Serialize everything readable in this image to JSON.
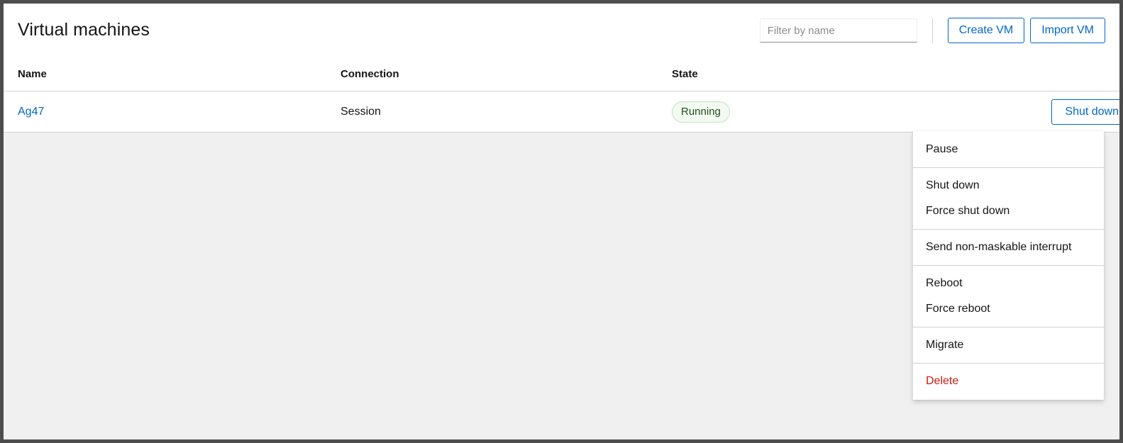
{
  "header": {
    "title": "Virtual machines"
  },
  "toolbar": {
    "filter_placeholder": "Filter by name",
    "filter_value": "",
    "create_vm_label": "Create VM",
    "import_vm_label": "Import VM"
  },
  "table": {
    "columns": [
      "Name",
      "Connection",
      "State",
      ""
    ],
    "rows": [
      {
        "name": "Ag47",
        "connection": "Session",
        "state": "Running",
        "primary_action": "Shut down",
        "kebab_icon": "kebab-vertical-icon"
      }
    ]
  },
  "dropdown": {
    "open": true,
    "groups": [
      {
        "items": [
          {
            "label": "Pause",
            "danger": false
          }
        ]
      },
      {
        "items": [
          {
            "label": "Shut down",
            "danger": false
          },
          {
            "label": "Force shut down",
            "danger": false
          }
        ]
      },
      {
        "items": [
          {
            "label": "Send non-maskable interrupt",
            "danger": false
          }
        ]
      },
      {
        "items": [
          {
            "label": "Reboot",
            "danger": false
          },
          {
            "label": "Force reboot",
            "danger": false
          }
        ]
      },
      {
        "items": [
          {
            "label": "Migrate",
            "danger": false
          }
        ]
      },
      {
        "items": [
          {
            "label": "Delete",
            "danger": true
          }
        ]
      }
    ]
  },
  "colors": {
    "link": "#0066cc",
    "danger": "#c9190b",
    "state_running_text": "#1e4f18",
    "state_running_bg": "#f3faf2",
    "state_running_border": "#bde5b8",
    "page_bg": "#f0f0f0",
    "frame_border": "#4d4d4d"
  }
}
